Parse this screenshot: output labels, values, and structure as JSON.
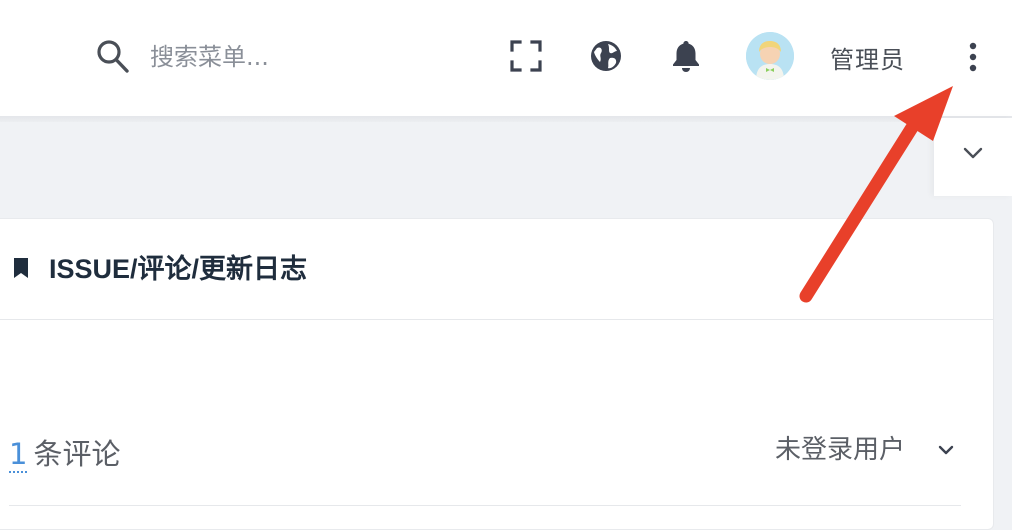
{
  "header": {
    "search": {
      "placeholder": "搜索菜单..."
    },
    "icons": {
      "search": "search-icon",
      "fullscreen": "fullscreen-icon",
      "language": "globe-icon",
      "notifications": "bell-icon",
      "more": "more-vertical-icon"
    },
    "user": {
      "name": "管理员"
    }
  },
  "tabs_bar": {
    "toggle_icon": "chevron-down-icon"
  },
  "card": {
    "title": "ISSUE/评论/更新日志",
    "comment_count": "1",
    "comment_label": "条评论",
    "login_user": "未登录用户"
  },
  "annotation": {
    "arrow_color": "#e8402a"
  },
  "colors": {
    "link": "#4a90d9",
    "title": "#1f2d3d",
    "icon": "#3c4250"
  }
}
